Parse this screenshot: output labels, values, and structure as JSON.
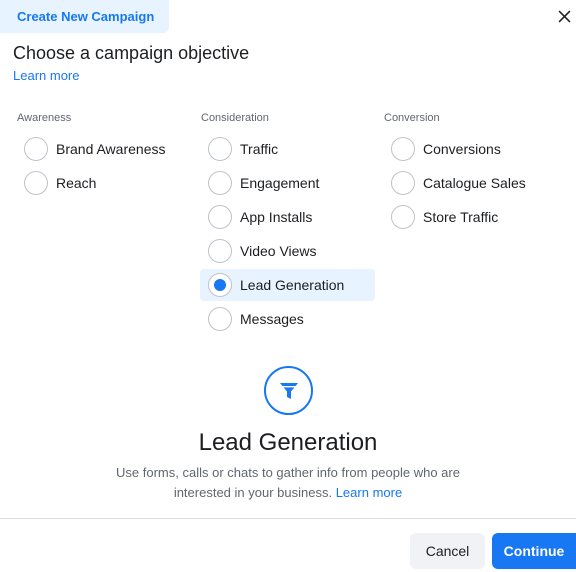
{
  "header": {
    "tab_label": "Create New Campaign",
    "close_icon": "close-icon"
  },
  "main": {
    "title": "Choose a campaign objective",
    "learn_more": "Learn more"
  },
  "columns": [
    {
      "title": "Awareness",
      "options": [
        {
          "label": "Brand Awareness",
          "selected": false
        },
        {
          "label": "Reach",
          "selected": false
        }
      ]
    },
    {
      "title": "Consideration",
      "options": [
        {
          "label": "Traffic",
          "selected": false
        },
        {
          "label": "Engagement",
          "selected": false
        },
        {
          "label": "App Installs",
          "selected": false
        },
        {
          "label": "Video Views",
          "selected": false
        },
        {
          "label": "Lead Generation",
          "selected": true
        },
        {
          "label": "Messages",
          "selected": false
        }
      ]
    },
    {
      "title": "Conversion",
      "options": [
        {
          "label": "Conversions",
          "selected": false
        },
        {
          "label": "Catalogue Sales",
          "selected": false
        },
        {
          "label": "Store Traffic",
          "selected": false
        }
      ]
    }
  ],
  "detail": {
    "icon": "funnel-icon",
    "title": "Lead Generation",
    "description": "Use forms, calls or chats to gather info from people who are interested in your business.",
    "learn_more": "Learn more"
  },
  "footer": {
    "cancel_label": "Cancel",
    "continue_label": "Continue"
  },
  "colors": {
    "accent": "#1877f2",
    "selected_bg": "#e7f3ff",
    "muted_text": "#606770"
  }
}
